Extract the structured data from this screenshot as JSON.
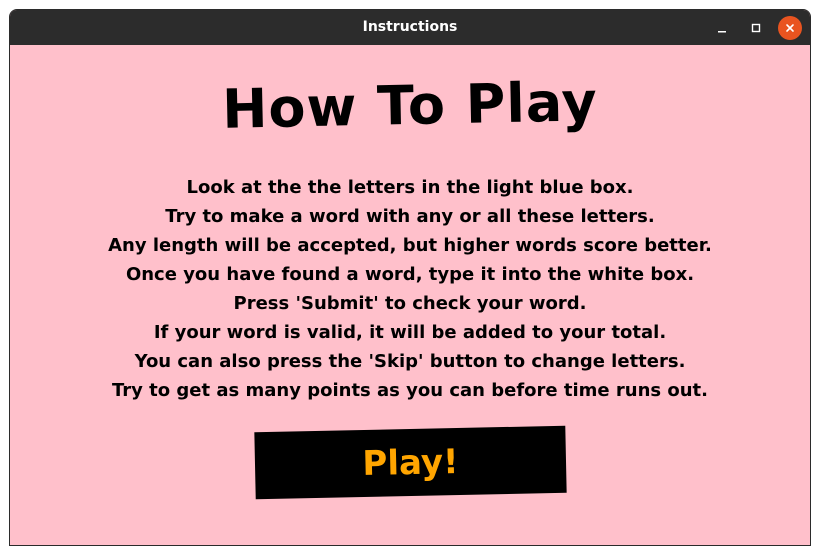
{
  "window": {
    "title": "Instructions",
    "controls": {
      "minimize_icon": "minimize-icon",
      "maximize_icon": "maximize-icon",
      "close_icon": "close-icon",
      "close_color": "#e95420"
    }
  },
  "content": {
    "heading": "How To Play",
    "background_color": "#ffc0cb",
    "instructions": [
      "Look at the the letters in the light blue box.",
      "Try to make a word with any or all these letters.",
      "Any length will be accepted, but higher words score better.",
      "Once you have found a word, type it into the white box.",
      "Press 'Submit' to check your word.",
      "If your word is valid, it will be added to your total.",
      "You can also press the 'Skip' button to change letters.",
      "Try to get as many points as you can before time runs out."
    ],
    "play_button": {
      "label": "Play!",
      "background": "#000000",
      "text_color": "#ffa500"
    }
  }
}
